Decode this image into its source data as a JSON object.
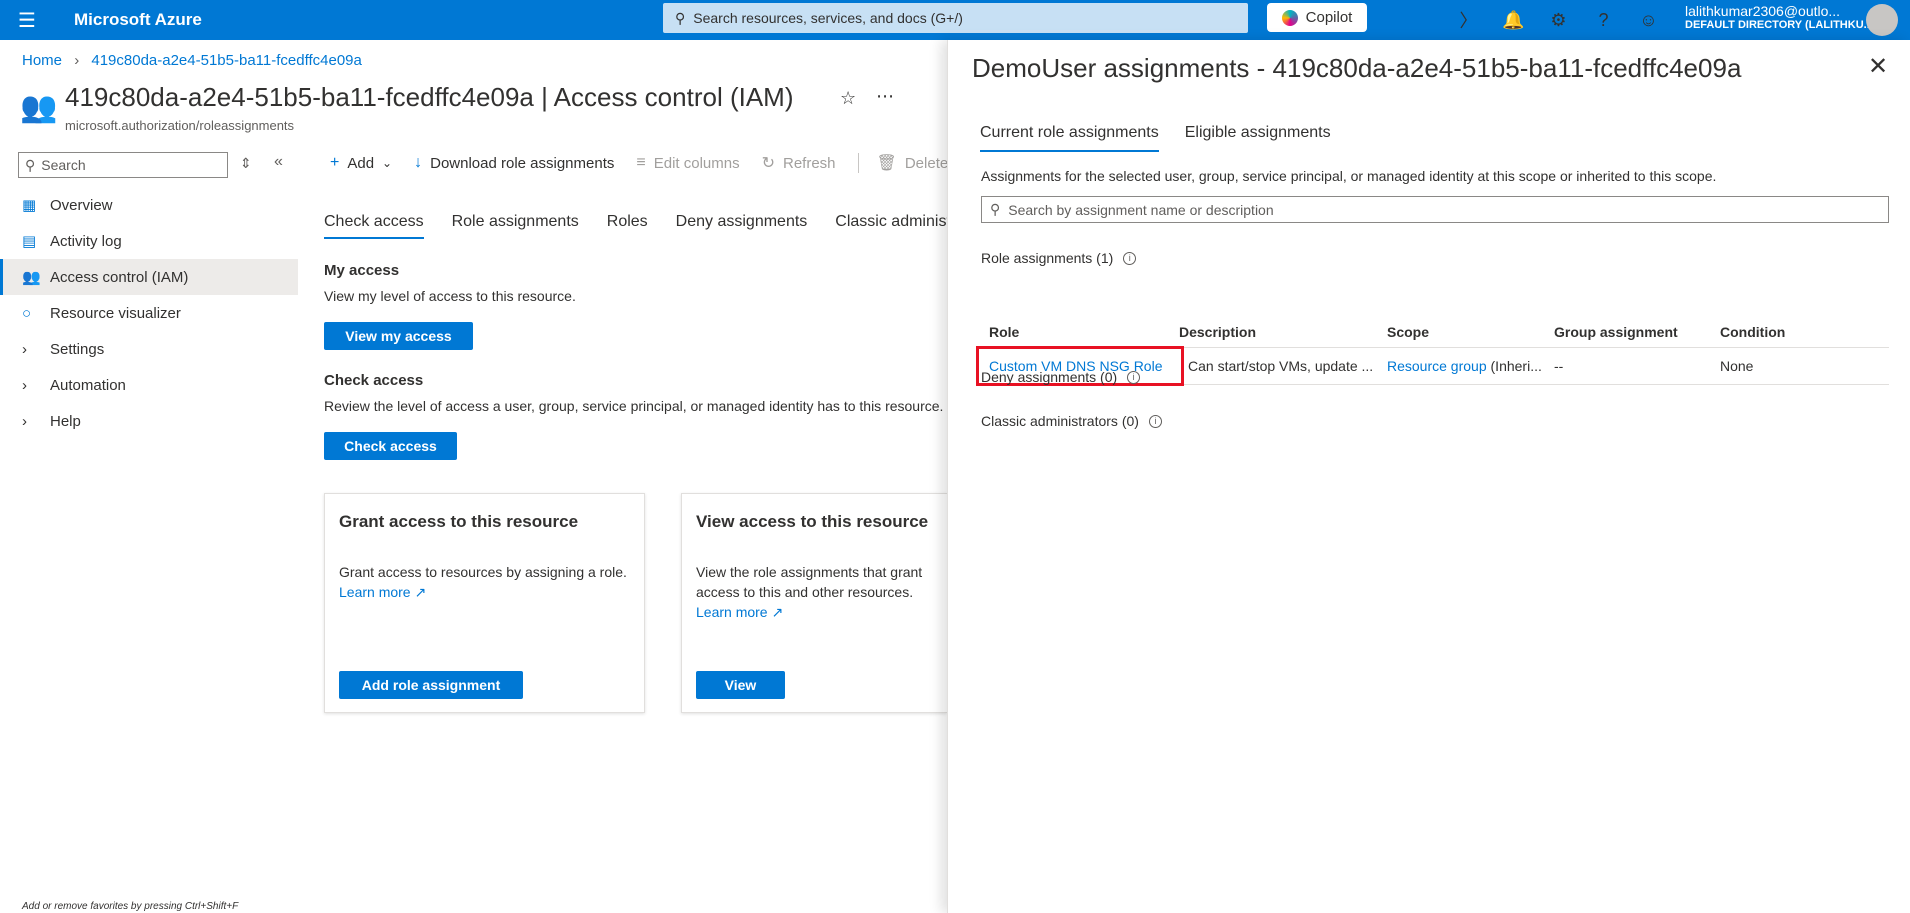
{
  "topbar": {
    "brand": "Microsoft Azure",
    "search_placeholder": "Search resources, services, and docs (G+/)",
    "copilot_label": "Copilot",
    "account_name": "lalithkumar2306@outlo...",
    "account_directory": "DEFAULT DIRECTORY (LALITHKU..."
  },
  "breadcrumb": {
    "home": "Home",
    "current": "419c80da-a2e4-51b5-ba11-fcedffc4e09a"
  },
  "page": {
    "title_resource": "419c80da-a2e4-51b5-ba11-fcedffc4e09a",
    "title_sep": " | ",
    "title_section": "Access control (IAM)",
    "subtitle": "microsoft.authorization/roleassignments"
  },
  "sidebar": {
    "search_placeholder": "Search",
    "items": [
      {
        "label": "Overview",
        "icon": "overview-icon"
      },
      {
        "label": "Activity log",
        "icon": "activity-log-icon"
      },
      {
        "label": "Access control (IAM)",
        "icon": "iam-icon"
      },
      {
        "label": "Resource visualizer",
        "icon": "visualizer-icon"
      },
      {
        "label": "Settings",
        "icon": "chevron-right-icon"
      },
      {
        "label": "Automation",
        "icon": "chevron-right-icon"
      },
      {
        "label": "Help",
        "icon": "chevron-right-icon"
      }
    ],
    "footer_hint": "Add or remove favorites by pressing Ctrl+Shift+F"
  },
  "toolbar": {
    "add": "Add",
    "download": "Download role assignments",
    "edit_columns": "Edit columns",
    "refresh": "Refresh",
    "delete": "Delete"
  },
  "tabs": [
    "Check access",
    "Role assignments",
    "Roles",
    "Deny assignments",
    "Classic administrators"
  ],
  "my_access": {
    "heading": "My access",
    "text": "View my level of access to this resource.",
    "button": "View my access"
  },
  "check_access": {
    "heading": "Check access",
    "text": "Review the level of access a user, group, service principal, or managed identity has to this resource.",
    "button": "Check access"
  },
  "cards": {
    "grant": {
      "title": "Grant access to this resource",
      "text": "Grant access to resources by assigning a role.",
      "link": "Learn more",
      "button": "Add role assignment"
    },
    "view": {
      "title": "View access to this resource",
      "text": "View the role assignments that grant access to this and other resources.",
      "link": "Learn more",
      "button": "View"
    }
  },
  "panel": {
    "title": "DemoUser assignments - 419c80da-a2e4-51b5-ba11-fcedffc4e09a",
    "tabs": [
      "Current role assignments",
      "Eligible assignments"
    ],
    "description": "Assignments for the selected user, group, service principal, or managed identity at this scope or inherited to this scope.",
    "search_placeholder": "Search by assignment name or description",
    "role_assignments_label": "Role assignments (1)",
    "table": {
      "headers": [
        "Role",
        "Description",
        "Scope",
        "Group assignment",
        "Condition"
      ],
      "rows": [
        {
          "role": "Custom VM DNS NSG Role",
          "description": "Can start/stop VMs, update ...",
          "scope_link": "Resource group",
          "scope_suffix": " (Inheri...",
          "group": "--",
          "condition": "None"
        }
      ]
    },
    "deny_label": "Deny assignments (0)",
    "classic_label": "Classic administrators (0)"
  }
}
